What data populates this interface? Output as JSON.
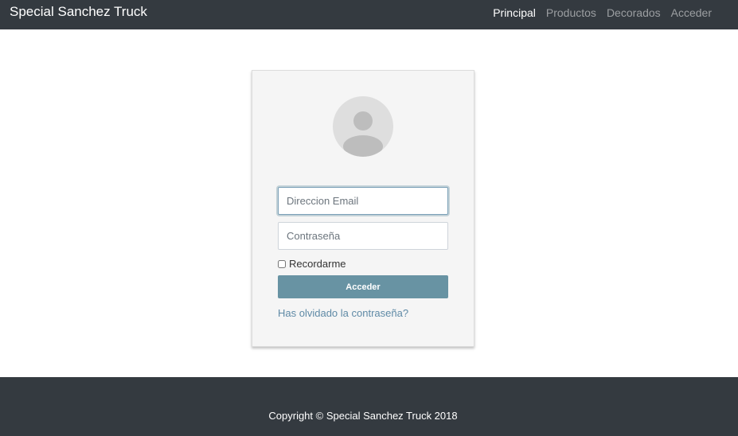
{
  "navbar": {
    "brand": "Special Sanchez Truck",
    "items": [
      {
        "label": "Principal",
        "active": true
      },
      {
        "label": "Productos",
        "active": false
      },
      {
        "label": "Decorados",
        "active": false
      },
      {
        "label": "Acceder",
        "active": false
      }
    ]
  },
  "login": {
    "avatar_icon": "user-avatar-icon",
    "email": {
      "placeholder": "Direccion Email",
      "value": "",
      "focused": true
    },
    "password": {
      "placeholder": "Contraseña",
      "value": ""
    },
    "remember_label": "Recordarme",
    "remember_checked": false,
    "submit_label": "Acceder",
    "forgot_link": "Has olvidado la contraseña?"
  },
  "footer": {
    "copyright": "Copyright © Special Sanchez Truck 2018"
  },
  "colors": {
    "navbar_bg": "#343a40",
    "button_bg": "#6893a3",
    "link": "#5f8aa6",
    "card_bg": "#f5f5f5"
  }
}
